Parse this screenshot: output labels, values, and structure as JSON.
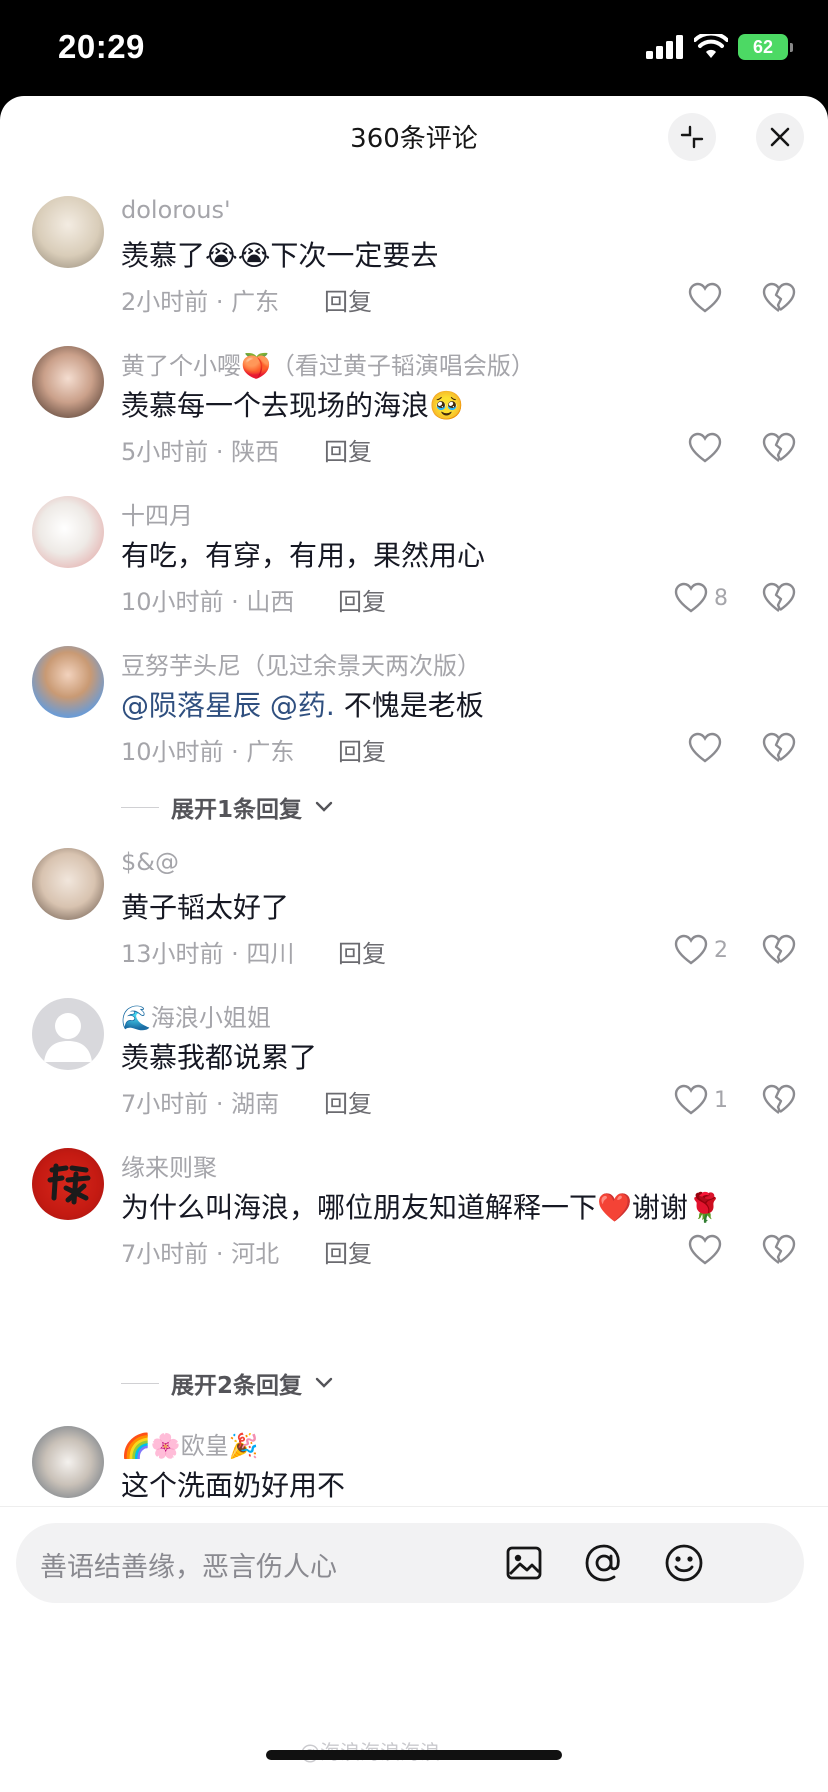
{
  "status_bar": {
    "time": "20:29",
    "battery": "62"
  },
  "header": {
    "title": "360条评论"
  },
  "comments": [
    {
      "user": "dolorous'",
      "text": "羡慕了😭😭下次一定要去",
      "time_loc": "2小时前 · 广东",
      "reply": "回复",
      "likes": ""
    },
    {
      "user": "黄了个小嘤🍑（看过黄子韬演唱会版）",
      "text": "羡慕每一个去现场的海浪🥹",
      "time_loc": "5小时前 · 陕西",
      "reply": "回复",
      "likes": ""
    },
    {
      "user": "十四月",
      "text": "有吃，有穿，有用，果然用心",
      "time_loc": "10小时前 · 山西",
      "reply": "回复",
      "likes": "8"
    },
    {
      "user": "豆努芋头尼（见过余景天两次版）",
      "mention1": "@陨落星辰",
      "mention2": "@药.",
      "text": " 不愧是老板",
      "time_loc": "10小时前 · 广东",
      "reply": "回复",
      "likes": ""
    },
    {
      "user": "$&@",
      "text": "黄子韬太好了",
      "time_loc": "13小时前 · 四川",
      "reply": "回复",
      "likes": "2"
    },
    {
      "user": "🌊海浪小姐姐",
      "text": "羡慕我都说累了",
      "time_loc": "7小时前 · 湖南",
      "reply": "回复",
      "likes": "1"
    },
    {
      "user": "缘来则聚",
      "text": "为什么叫海浪，哪位朋友知道解释一下❤️谢谢🌹",
      "time_loc": "7小时前 · 河北",
      "reply": "回复",
      "likes": ""
    },
    {
      "user": "🌈🌸欧皇🎉",
      "text": "这个洗面奶好用不"
    }
  ],
  "expand_1": "展开1条回复",
  "expand_2": "展开2条回复",
  "input": {
    "placeholder": "善语结善缘，恶言伤人心"
  },
  "watermark": "@海浪海浪海浪",
  "colors": {
    "mention": "#2f4f7f",
    "battery": "#4cd964",
    "meta": "#a5a5aa"
  }
}
